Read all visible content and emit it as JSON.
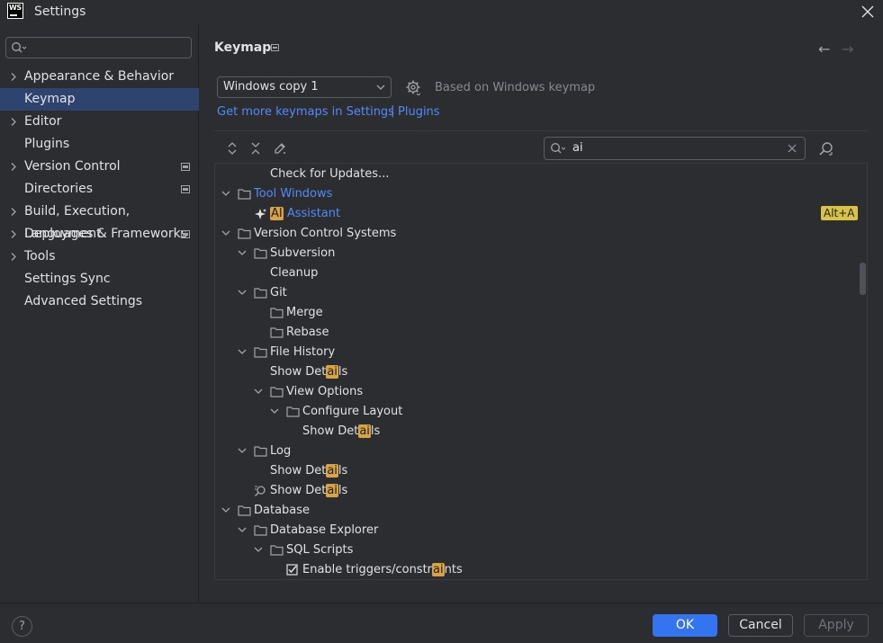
{
  "window": {
    "title": "Settings",
    "app_logo": "WS"
  },
  "sidebar": {
    "search_placeholder": "",
    "items": [
      {
        "label": "Appearance & Behavior",
        "expandable": true,
        "project": false,
        "selected": false
      },
      {
        "label": "Keymap",
        "expandable": false,
        "project": false,
        "selected": true
      },
      {
        "label": "Editor",
        "expandable": true,
        "project": false,
        "selected": false
      },
      {
        "label": "Plugins",
        "expandable": false,
        "project": false,
        "selected": false
      },
      {
        "label": "Version Control",
        "expandable": true,
        "project": true,
        "selected": false
      },
      {
        "label": "Directories",
        "expandable": false,
        "project": true,
        "selected": false
      },
      {
        "label": "Build, Execution, Deployment",
        "expandable": true,
        "project": false,
        "selected": false
      },
      {
        "label": "Languages & Frameworks",
        "expandable": true,
        "project": true,
        "selected": false
      },
      {
        "label": "Tools",
        "expandable": true,
        "project": false,
        "selected": false
      },
      {
        "label": "Settings Sync",
        "expandable": false,
        "project": false,
        "selected": false
      },
      {
        "label": "Advanced Settings",
        "expandable": false,
        "project": false,
        "selected": false
      }
    ]
  },
  "main": {
    "title": "Keymap",
    "keymap_select": "Windows copy 1",
    "based_on": "Based on Windows keymap",
    "link_settings": "Get more keymaps in Settings",
    "link_sep": "|",
    "link_plugins": "Plugins",
    "filter_value": "ai",
    "tree": [
      {
        "indent": 3,
        "chevron": "none",
        "icon": "none",
        "pre": "Check for Updates...",
        "hl": "",
        "post": "",
        "blue": false,
        "shortcut": ""
      },
      {
        "indent": 1,
        "chevron": "down",
        "icon": "folder",
        "pre": "Tool Windows",
        "hl": "",
        "post": "",
        "blue": true,
        "shortcut": ""
      },
      {
        "indent": 2,
        "chevron": "none",
        "icon": "sparkle",
        "pre": "",
        "hl": "AI",
        "post": " Assistant",
        "blue": true,
        "shortcut": "Alt+A"
      },
      {
        "indent": 1,
        "chevron": "down",
        "icon": "folder",
        "pre": "Version Control Systems",
        "hl": "",
        "post": "",
        "blue": false,
        "shortcut": ""
      },
      {
        "indent": 2,
        "chevron": "down",
        "icon": "folder",
        "pre": "Subversion",
        "hl": "",
        "post": "",
        "blue": false,
        "shortcut": ""
      },
      {
        "indent": 3,
        "chevron": "none",
        "icon": "none",
        "pre": "Cleanup",
        "hl": "",
        "post": "",
        "blue": false,
        "shortcut": ""
      },
      {
        "indent": 2,
        "chevron": "down",
        "icon": "folder",
        "pre": "Git",
        "hl": "",
        "post": "",
        "blue": false,
        "shortcut": ""
      },
      {
        "indent": 3,
        "chevron": "none",
        "icon": "folder",
        "pre": "Merge",
        "hl": "",
        "post": "",
        "blue": false,
        "shortcut": ""
      },
      {
        "indent": 3,
        "chevron": "none",
        "icon": "folder",
        "pre": "Rebase",
        "hl": "",
        "post": "",
        "blue": false,
        "shortcut": ""
      },
      {
        "indent": 2,
        "chevron": "down",
        "icon": "folder",
        "pre": "File History",
        "hl": "",
        "post": "",
        "blue": false,
        "shortcut": ""
      },
      {
        "indent": 3,
        "chevron": "none",
        "icon": "none",
        "pre": "Show Det",
        "hl": "ai",
        "post": "ls",
        "blue": false,
        "shortcut": ""
      },
      {
        "indent": 3,
        "chevron": "down",
        "icon": "folder",
        "pre": "View Options",
        "hl": "",
        "post": "",
        "blue": false,
        "shortcut": ""
      },
      {
        "indent": 4,
        "chevron": "down",
        "icon": "folder",
        "pre": "Configure Layout",
        "hl": "",
        "post": "",
        "blue": false,
        "shortcut": ""
      },
      {
        "indent": 5,
        "chevron": "none",
        "icon": "none",
        "pre": "Show Det",
        "hl": "ai",
        "post": "ls",
        "blue": false,
        "shortcut": ""
      },
      {
        "indent": 2,
        "chevron": "down",
        "icon": "folder",
        "pre": "Log",
        "hl": "",
        "post": "",
        "blue": false,
        "shortcut": ""
      },
      {
        "indent": 3,
        "chevron": "none",
        "icon": "none",
        "pre": "Show Det",
        "hl": "ai",
        "post": "ls",
        "blue": false,
        "shortcut": ""
      },
      {
        "indent": 2,
        "chevron": "none",
        "icon": "search-doc",
        "pre": "Show Det",
        "hl": "ai",
        "post": "ls",
        "blue": false,
        "shortcut": ""
      },
      {
        "indent": 1,
        "chevron": "down",
        "icon": "folder",
        "pre": "Database",
        "hl": "",
        "post": "",
        "blue": false,
        "shortcut": ""
      },
      {
        "indent": 2,
        "chevron": "down",
        "icon": "folder",
        "pre": "Database Explorer",
        "hl": "",
        "post": "",
        "blue": false,
        "shortcut": ""
      },
      {
        "indent": 3,
        "chevron": "down",
        "icon": "folder",
        "pre": "SQL Scripts",
        "hl": "",
        "post": "",
        "blue": false,
        "shortcut": ""
      },
      {
        "indent": 4,
        "chevron": "none",
        "icon": "checkbox",
        "pre": "Enable triggers/constr",
        "hl": "ai",
        "post": "nts",
        "blue": false,
        "shortcut": ""
      }
    ]
  },
  "footer": {
    "help": "?",
    "ok": "OK",
    "cancel": "Cancel",
    "apply": "Apply"
  },
  "colors": {
    "background": "#2b2d30",
    "selection": "#2e436e",
    "link": "#548af7",
    "accent_button": "#3574f0",
    "highlight": "#d9a343"
  }
}
